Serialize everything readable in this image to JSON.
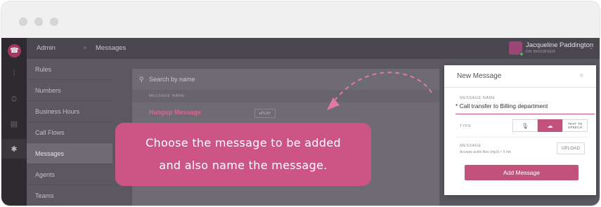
{
  "breadcrumb": {
    "root": "Admin",
    "separator": ">",
    "current": "Messages"
  },
  "user": {
    "name": "Jacqueline Paddington",
    "status": "ON BROWSER"
  },
  "nav": {
    "items": [
      {
        "label": "Rules"
      },
      {
        "label": "Numbers"
      },
      {
        "label": "Business Hours"
      },
      {
        "label": "Call Flows"
      },
      {
        "label": "Messages"
      },
      {
        "label": "Agents"
      },
      {
        "label": "Teams"
      }
    ],
    "active": "Messages"
  },
  "messages": {
    "search_placeholder": "Search by name",
    "column_header": "MESSAGE NAME",
    "rows": [
      {
        "name": "Hangup Message",
        "play_label": "PLAY"
      }
    ]
  },
  "modal": {
    "title": "New Message",
    "close": "×",
    "name_label": "MESSAGE NAME",
    "name_value": "* Call transfer to Billing department",
    "type_label": "TYPE",
    "type_tts": "TEXT TO SPEECH",
    "message_label": "MESSAGE",
    "help_text": "Accepts audio files (mp3) < 5 mb",
    "upload_label": "UPLOAD",
    "add_label": "Add Message"
  },
  "tip": {
    "line1": "Choose the message to be added",
    "line2": "and also name the message."
  },
  "colors": {
    "accent": "#c2527b",
    "tip": "#cc5586",
    "rail": "#2e2a30"
  }
}
